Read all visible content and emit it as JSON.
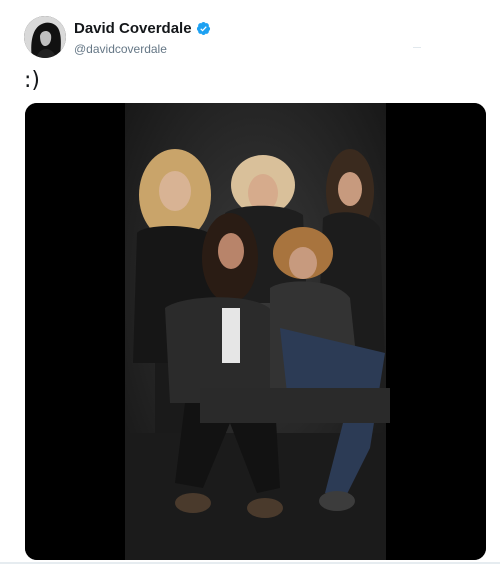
{
  "author": {
    "display_name": "David Coverdale",
    "handle": "@davidcoverdale",
    "verified": true
  },
  "tweet": {
    "text": ":)"
  },
  "media": {
    "type": "video",
    "description": "band-photo"
  },
  "icons": {
    "verified": "verified-badge-icon",
    "avatar": "avatar"
  },
  "colors": {
    "verified_blue": "#1da1f2",
    "name": "#14171a",
    "handle": "#657786",
    "media_bg": "#000000"
  }
}
